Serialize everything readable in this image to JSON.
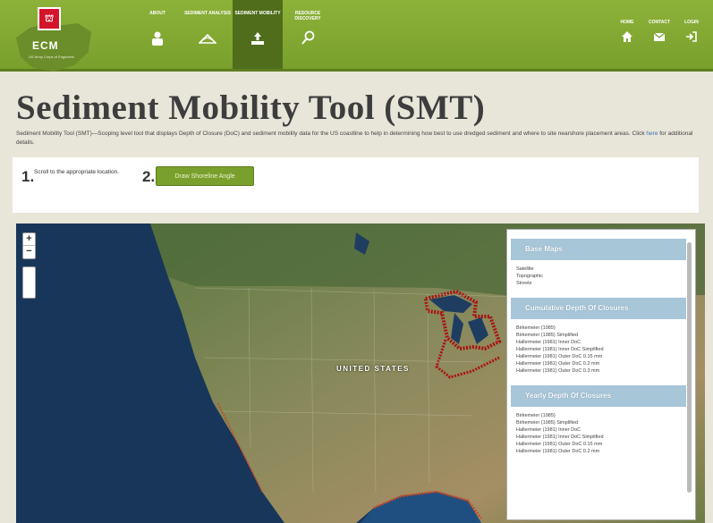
{
  "header": {
    "logo_text": "ECM",
    "logo_sub": "US Army Corps of Engineers",
    "nav": [
      {
        "label": "About",
        "icon": "person-icon",
        "active": false
      },
      {
        "label": "Sediment Analysis",
        "icon": "layers-icon",
        "active": false
      },
      {
        "label": "Sediment Mobility",
        "icon": "upload-icon",
        "active": true
      },
      {
        "label": "Resource Discovery",
        "icon": "search-icon",
        "active": false
      }
    ],
    "right_nav": [
      {
        "label": "Home",
        "icon": "home-icon"
      },
      {
        "label": "Contact",
        "icon": "mail-icon"
      },
      {
        "label": "Login",
        "icon": "login-icon"
      }
    ]
  },
  "page": {
    "title": "Sediment Mobility Tool (SMT)",
    "description": "Sediment Mobility Tool (SMT)—Scoping level tool that displays Depth of Closure (DoC) and sediment mobility data for the US coastline to help in determining how best to use dredged sediment and where to site nearshore placement areas. Click",
    "description_link": "here",
    "description_end": "for additional details."
  },
  "steps": {
    "step1_num": "1.",
    "step1_text": "Scroll to the appropriate location.",
    "step2_num": "2.",
    "step2_button": "Draw Shoreline Angle"
  },
  "map": {
    "label": "UNITED STATES",
    "zoom_in": "+",
    "zoom_out": "−"
  },
  "layers": {
    "base_maps_title": "Base Maps",
    "base_maps": [
      "Satellite",
      "Topographic",
      "Streets"
    ],
    "cumulative_title": "Cumulative Depth Of Closures",
    "cumulative_items": [
      "Birkemeier (1985)",
      "Birkemeier (1985) Simplified",
      "Hallermeier (1981) Inner DoC",
      "Hallermeier (1981) Inner DoC Simplified",
      "Hallermeier (1981) Outer DoC 0.15 mm",
      "Hallermeier (1981) Outer DoC 0.2 mm",
      "Hallermeier (1981) Outer DoC 0.3 mm"
    ],
    "yearly_title": "Yearly Depth Of Closures",
    "yearly_items": [
      "Birkemeier (1985)",
      "Birkemeier (1985) Simplified",
      "Hallermeier (1981) Inner DoC",
      "Hallermeier (1981) Inner DoC Simplified",
      "Hallermeier (1981) Outer DoC 0.15 mm",
      "Hallermeier (1981) Outer DoC 0.2 mm"
    ]
  },
  "colors": {
    "header_green": "#79a02c",
    "active_nav": "#4f6d1b",
    "panel_header": "#a7c6d8",
    "doc_marker": "#8b1a1a"
  }
}
